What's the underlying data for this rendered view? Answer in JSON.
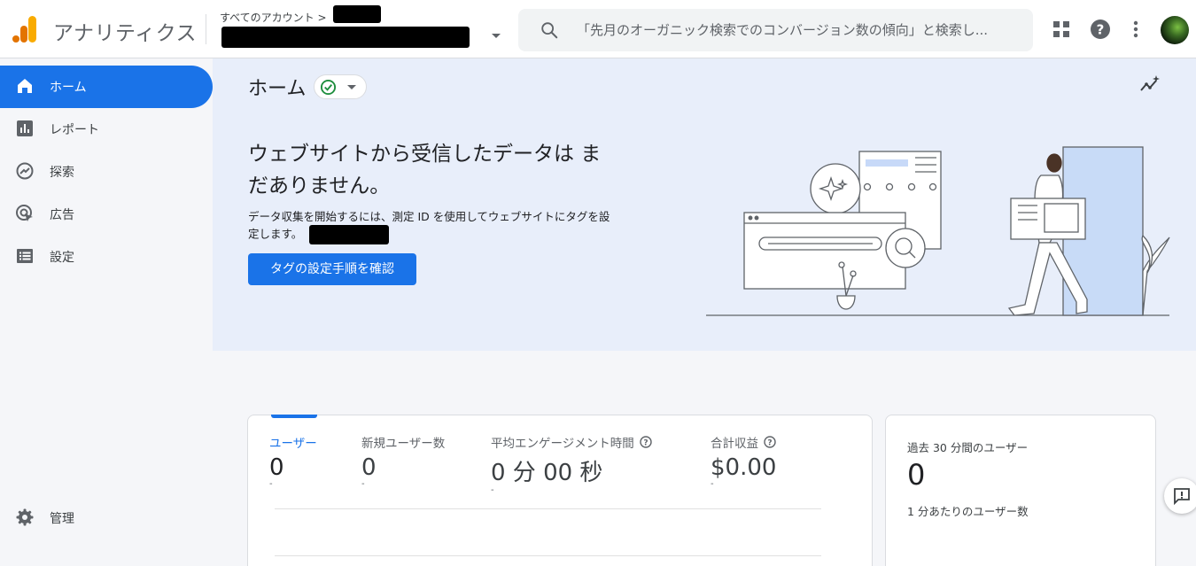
{
  "header": {
    "app_name": "アナリティクス",
    "account_crumb": "すべてのアカウント >",
    "search_placeholder": "「先月のオーガニック検索でのコンバージョン数の傾向」と検索し..."
  },
  "sidebar": {
    "items": [
      {
        "label": "ホーム",
        "icon": "home-icon",
        "active": true
      },
      {
        "label": "レポート",
        "icon": "bar-chart-icon",
        "active": false
      },
      {
        "label": "探索",
        "icon": "explore-icon",
        "active": false
      },
      {
        "label": "広告",
        "icon": "ads-icon",
        "active": false
      },
      {
        "label": "設定",
        "icon": "list-icon",
        "active": false
      }
    ],
    "admin_label": "管理"
  },
  "main": {
    "title": "ホーム",
    "banner_heading": "ウェブサイトから受信したデータは まだありません。",
    "banner_desc": "データ収集を開始するには、測定 ID を使用してウェブサイトにタグを設定します。",
    "tag_button_label": "タグの設定手順を確認"
  },
  "metrics": [
    {
      "label": "ユーザー",
      "value": "0",
      "sub": "-",
      "selected": true,
      "help": false
    },
    {
      "label": "新規ユーザー数",
      "value": "0",
      "sub": "-",
      "selected": false,
      "help": false
    },
    {
      "label": "平均エンゲージメント時間",
      "value": "0 分 00 秒",
      "sub": "-",
      "selected": false,
      "help": true
    },
    {
      "label": "合計収益",
      "value": "$0.00",
      "sub": "-",
      "selected": false,
      "help": true
    }
  ],
  "realtime": {
    "title": "過去 30 分間のユーザー",
    "value": "0",
    "subtitle": "1 分あたりのユーザー数"
  },
  "colors": {
    "accent": "#1a73e8",
    "banner_bg": "#e8eefa",
    "logo_orange": "#f9ab00",
    "logo_dark_orange": "#e37400",
    "status_green": "#1e8e3e"
  }
}
